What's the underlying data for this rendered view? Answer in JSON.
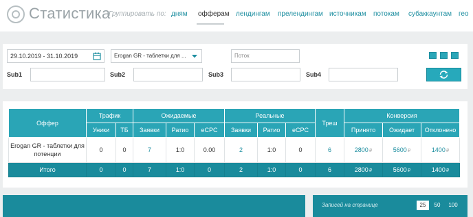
{
  "header": {
    "title": "Статистика",
    "group_label": "Группировать по:",
    "nav": [
      "дням",
      "офферам",
      "лендингам",
      "прелендингам",
      "источникам",
      "потокам",
      "субаккаунтам",
      "гео"
    ],
    "active_nav": "офферам"
  },
  "filters": {
    "date_range": "29.10.2019 - 31.10.2019",
    "offer_select": "Erogan GR - таблетки для ...",
    "stream_placeholder": "Поток",
    "sub_labels": [
      "Sub1",
      "Sub2",
      "Sub3",
      "Sub4"
    ]
  },
  "table": {
    "groups": {
      "offer": "Оффер",
      "traffic": "Трафик",
      "expected": "Ожидаемые",
      "real": "Реальные",
      "trash": "Треш",
      "conversion": "Конверсия"
    },
    "subheaders": {
      "uniques": "Уники",
      "tb": "ТБ",
      "requests_exp": "Заявки",
      "ratio_exp": "Ратио",
      "ecpc_exp": "eCPC",
      "requests_real": "Заявки",
      "ratio_real": "Ратио",
      "ecpc_real": "eCPC",
      "accepted": "Принято",
      "waiting": "Ожидает",
      "rejected": "Отклонено"
    },
    "row": {
      "offer": "Erogan GR - таблетки для потенции",
      "uniques": "0",
      "tb": "0",
      "requests_exp": "7",
      "ratio_exp": "1:0",
      "ecpc_exp": "0.00",
      "requests_real": "2",
      "ratio_real": "1:0",
      "ecpc_real": "0",
      "trash": "6",
      "accepted": "2800",
      "waiting": "5600",
      "rejected": "1400"
    },
    "total": {
      "label": "Итого",
      "uniques": "0",
      "tb": "0",
      "requests_exp": "7",
      "ratio_exp": "1:0",
      "ecpc_exp": "0",
      "requests_real": "2",
      "ratio_real": "1:0",
      "ecpc_real": "0",
      "trash": "6",
      "accepted": "2800",
      "waiting": "5600",
      "rejected": "1400"
    },
    "currency": "₽"
  },
  "pagination": {
    "label": "Записей на странице",
    "options": [
      "25",
      "50",
      "100"
    ],
    "active": "25"
  },
  "colors": {
    "accent": "#2aa5b6",
    "accent_dark": "#1a8b9c",
    "link": "#1d8ea0"
  }
}
